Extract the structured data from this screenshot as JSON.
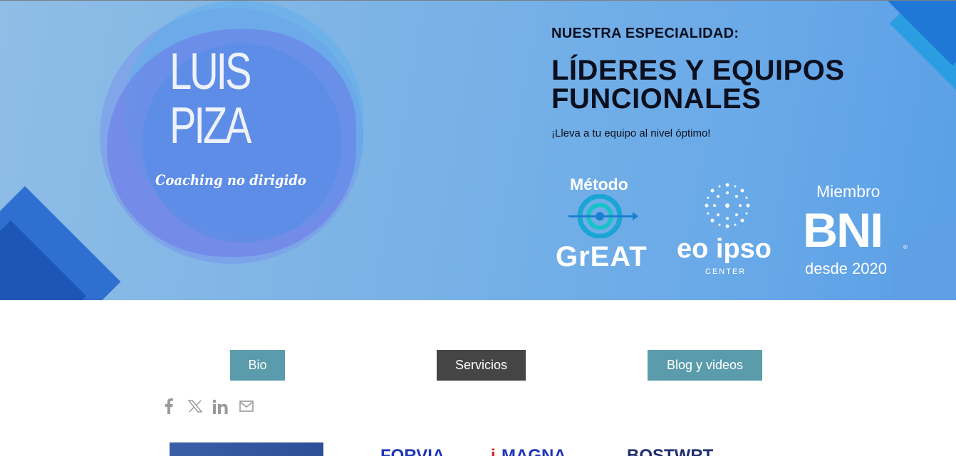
{
  "hero": {
    "logo_line1": "LUIS",
    "logo_line2": "PIZA",
    "logo_tagline": "Coaching no dirigido",
    "kicker": "NUESTRA ESPECIALIDAD:",
    "headline_line1": "LÍDERES Y EQUIPOS",
    "headline_line2": "FUNCIONALES",
    "subline": "¡Lleva a tu equipo al nivel óptimo!",
    "badges": {
      "metodo_label": "Método",
      "great_word": "GrEAT",
      "eoipso_word": "eo ipso",
      "eoipso_sub": "CENTER",
      "bni_top": "Miembro",
      "bni_word": "BNI",
      "bni_bottom": "desde 2020"
    }
  },
  "nav": {
    "bio": "Bio",
    "servicios": "Servicios",
    "blog": "Blog y videos"
  },
  "social": {
    "icons": [
      "facebook-icon",
      "x-icon",
      "linkedin-icon",
      "mail-icon"
    ]
  },
  "bottom_logos": {
    "logo1": "FORVIA",
    "logo2": "MAGNA",
    "logo3": "BOSTWRT"
  },
  "colors": {
    "teal_button": "#5a9cab",
    "dark_button": "#454545",
    "hero_blue": "#79b2e6",
    "headline_dark": "#0b0f1e",
    "social_gray": "#9a9a9a"
  }
}
